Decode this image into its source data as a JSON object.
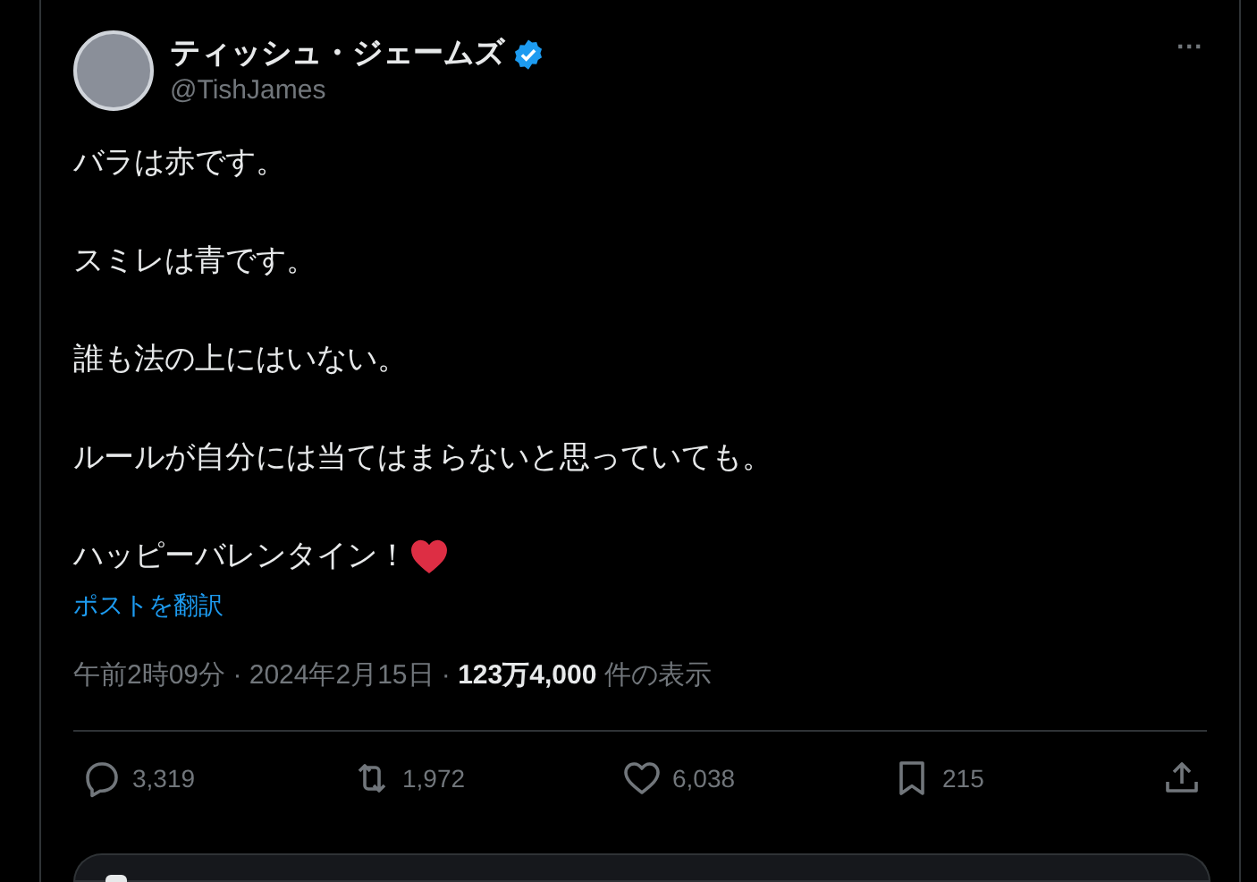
{
  "post": {
    "author": {
      "name": "ティッシュ・ジェームズ",
      "handle": "@TishJames",
      "verified": true
    },
    "more_button": "···",
    "paragraphs": [
      {
        "text": "バラは赤です。",
        "heart": false
      },
      {
        "text": "スミレは青です。",
        "heart": false
      },
      {
        "text": "誰も法の上にはいない。",
        "heart": false
      },
      {
        "text": "ルールが自分には当てはまらないと思っていても。",
        "heart": false
      },
      {
        "text": "ハッピーバレンタイン！",
        "heart": true
      }
    ],
    "translate_link": "ポストを翻訳",
    "meta": "午前2時09分 · 2024年2月15日 · **123万4,000** 件の表示",
    "actions": [
      {
        "kind": "reply",
        "count": "3,319"
      },
      {
        "kind": "repost",
        "count": "1,972"
      },
      {
        "kind": "like",
        "count": "6,038"
      },
      {
        "kind": "bookmark",
        "count": "215"
      },
      {
        "kind": "share"
      }
    ]
  }
}
